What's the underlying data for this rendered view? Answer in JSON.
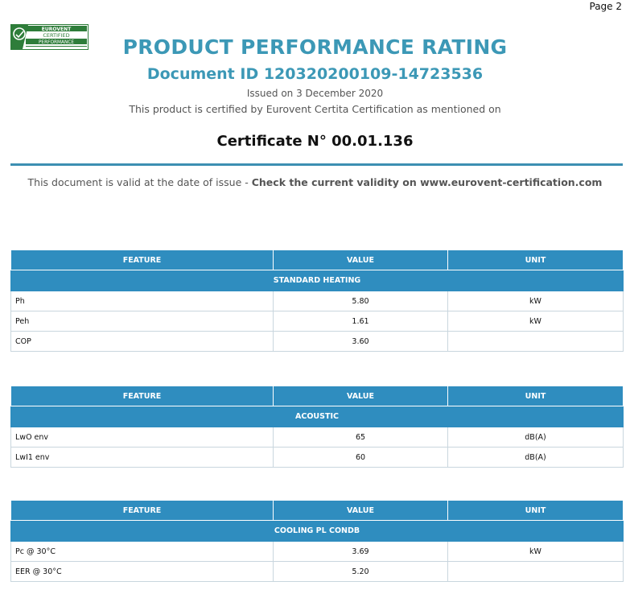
{
  "page_label": "Page 2",
  "logo": {
    "line1": "EUROVENT",
    "line2": "CERTIFIED",
    "line3": "PERFORMANCE",
    "colors": {
      "green": "#2e7d3a",
      "white": "#ffffff"
    }
  },
  "header": {
    "title": "PRODUCT PERFORMANCE RATING",
    "document_id": "Document ID 120320200109-14723536",
    "issued": "Issued on  3 December 2020",
    "certified_text": "This product is certified by Eurovent Certita Certification as mentioned on",
    "certificate": "Certificate N° 00.01.136"
  },
  "validity": {
    "prefix": "This document is valid at the date of issue - ",
    "bold": "Check the current validity on www.eurovent-certification.com"
  },
  "columns": {
    "feature": "FEATURE",
    "value": "VALUE",
    "unit": "UNIT"
  },
  "tables": [
    {
      "section": "STANDARD HEATING",
      "rows": [
        {
          "feature": "Ph",
          "value": "5.80",
          "unit": "kW"
        },
        {
          "feature": "Peh",
          "value": "1.61",
          "unit": "kW"
        },
        {
          "feature": "COP",
          "value": "3.60",
          "unit": ""
        }
      ]
    },
    {
      "section": "ACOUSTIC",
      "rows": [
        {
          "feature": "LwO env",
          "value": "65",
          "unit": "dB(A)"
        },
        {
          "feature": "LwI1 env",
          "value": "60",
          "unit": "dB(A)"
        }
      ]
    },
    {
      "section": "COOLING PL CONDB",
      "rows": [
        {
          "feature": "Pc @ 30°C",
          "value": "3.69",
          "unit": "kW"
        },
        {
          "feature": "EER @ 30°C",
          "value": "5.20",
          "unit": ""
        }
      ]
    }
  ],
  "colors": {
    "accent": "#3c98b6",
    "table_header": "#2f8dbf"
  }
}
